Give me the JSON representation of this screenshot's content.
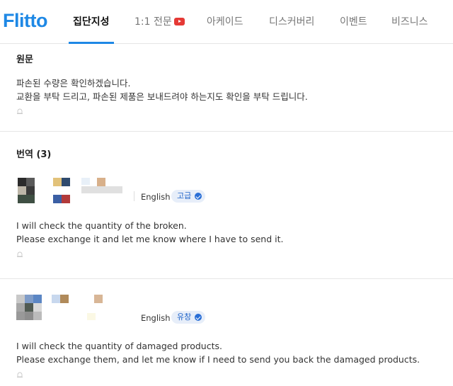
{
  "header": {
    "logo": "Flitto",
    "tabs": [
      {
        "label": "집단지성",
        "active": true
      },
      {
        "label": "1:1 전문",
        "active": false
      },
      {
        "label": "아케이드",
        "active": false
      },
      {
        "label": "디스커버리",
        "active": false
      },
      {
        "label": "이벤트",
        "active": false
      },
      {
        "label": "비즈니스",
        "active": false
      }
    ]
  },
  "original": {
    "title": "원문",
    "lines": [
      "파손된 수량은 확인하겠습니다.",
      "교환을 부탁 드리고, 파손된 제품은 보내드려야 하는지도 확인을 부탁 드립니다."
    ]
  },
  "translations": {
    "title": "번역 (3)",
    "items": [
      {
        "language": "English",
        "level": "고급",
        "lines": [
          "I will check the quantity of the broken.",
          "Please exchange it and let me know where I have to send it."
        ]
      },
      {
        "language": "English",
        "level": "유창",
        "lines": [
          "I will check the quantity of damaged products.",
          "Please exchange them, and let me know if I need to send you back the damaged products."
        ]
      }
    ]
  },
  "colors": {
    "brand": "#1e88e5",
    "badge_bg": "#e7eef9",
    "badge_text": "#1e62c8",
    "youtube": "#e53935"
  },
  "icons": [
    "youtube-icon",
    "alarm-icon",
    "verified-check-icon"
  ]
}
